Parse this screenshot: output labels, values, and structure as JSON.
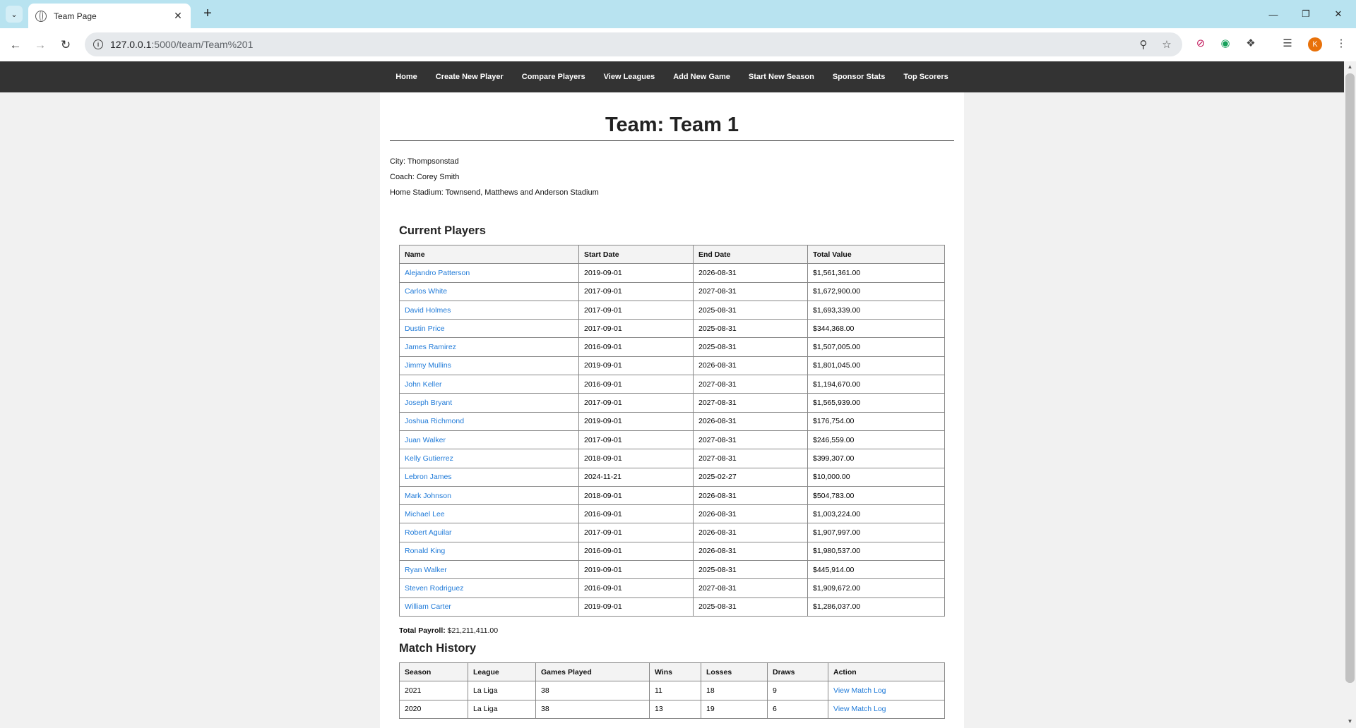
{
  "browser": {
    "tab_title": "Team Page",
    "url_host": "127.0.0.1",
    "url_path": ":5000/team/Team%201",
    "avatar_letter": "K"
  },
  "nav": {
    "items": [
      "Home",
      "Create New Player",
      "Compare Players",
      "View Leagues",
      "Add New Game",
      "Start New Season",
      "Sponsor Stats",
      "Top Scorers"
    ]
  },
  "team": {
    "title": "Team: Team 1",
    "city": "City: Thompsonstad",
    "coach": "Coach: Corey Smith",
    "stadium": "Home Stadium: Townsend, Matthews and Anderson Stadium"
  },
  "players": {
    "heading": "Current Players",
    "columns": [
      "Name",
      "Start Date",
      "End Date",
      "Total Value"
    ],
    "rows": [
      [
        "Alejandro Patterson",
        "2019-09-01",
        "2026-08-31",
        "$1,561,361.00"
      ],
      [
        "Carlos White",
        "2017-09-01",
        "2027-08-31",
        "$1,672,900.00"
      ],
      [
        "David Holmes",
        "2017-09-01",
        "2025-08-31",
        "$1,693,339.00"
      ],
      [
        "Dustin Price",
        "2017-09-01",
        "2025-08-31",
        "$344,368.00"
      ],
      [
        "James Ramirez",
        "2016-09-01",
        "2025-08-31",
        "$1,507,005.00"
      ],
      [
        "Jimmy Mullins",
        "2019-09-01",
        "2026-08-31",
        "$1,801,045.00"
      ],
      [
        "John Keller",
        "2016-09-01",
        "2027-08-31",
        "$1,194,670.00"
      ],
      [
        "Joseph Bryant",
        "2017-09-01",
        "2027-08-31",
        "$1,565,939.00"
      ],
      [
        "Joshua Richmond",
        "2019-09-01",
        "2026-08-31",
        "$176,754.00"
      ],
      [
        "Juan Walker",
        "2017-09-01",
        "2027-08-31",
        "$246,559.00"
      ],
      [
        "Kelly Gutierrez",
        "2018-09-01",
        "2027-08-31",
        "$399,307.00"
      ],
      [
        "Lebron James",
        "2024-11-21",
        "2025-02-27",
        "$10,000.00"
      ],
      [
        "Mark Johnson",
        "2018-09-01",
        "2026-08-31",
        "$504,783.00"
      ],
      [
        "Michael Lee",
        "2016-09-01",
        "2026-08-31",
        "$1,003,224.00"
      ],
      [
        "Robert Aguilar",
        "2017-09-01",
        "2026-08-31",
        "$1,907,997.00"
      ],
      [
        "Ronald King",
        "2016-09-01",
        "2026-08-31",
        "$1,980,537.00"
      ],
      [
        "Ryan Walker",
        "2019-09-01",
        "2025-08-31",
        "$445,914.00"
      ],
      [
        "Steven Rodriguez",
        "2016-09-01",
        "2027-08-31",
        "$1,909,672.00"
      ],
      [
        "William Carter",
        "2019-09-01",
        "2025-08-31",
        "$1,286,037.00"
      ]
    ],
    "payroll_label": "Total Payroll:",
    "payroll_value": "$21,211,411.00"
  },
  "matches": {
    "heading": "Match History",
    "columns": [
      "Season",
      "League",
      "Games Played",
      "Wins",
      "Losses",
      "Draws",
      "Action"
    ],
    "rows": [
      [
        "2021",
        "La Liga",
        "38",
        "11",
        "18",
        "9",
        "View Match Log"
      ],
      [
        "2020",
        "La Liga",
        "38",
        "13",
        "19",
        "6",
        "View Match Log"
      ]
    ]
  }
}
